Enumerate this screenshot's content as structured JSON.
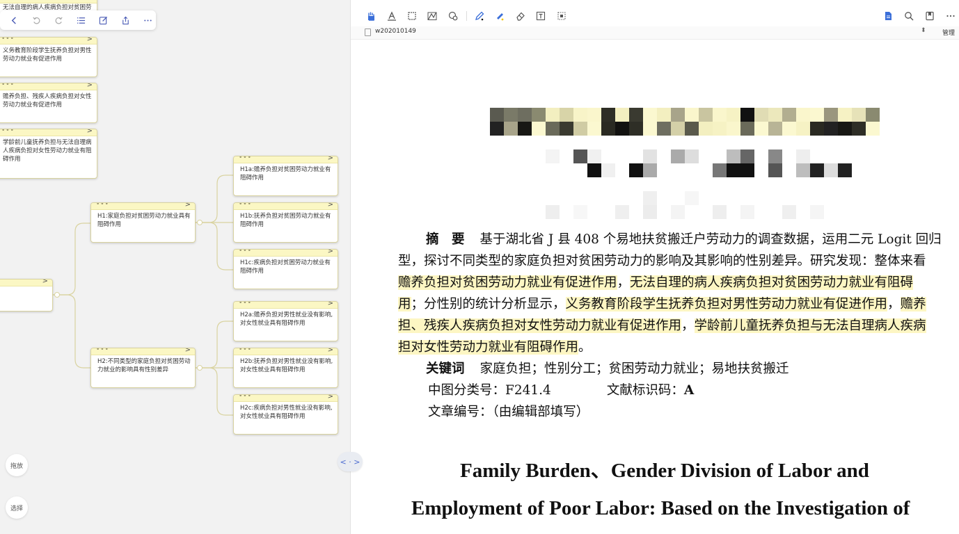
{
  "mindmap": {
    "toolbar": {
      "buttons": [
        "back-icon",
        "undo-icon",
        "redo-icon",
        "outline-icon",
        "edit-icon",
        "share-icon",
        "more-icon"
      ]
    },
    "nodes": {
      "n0": "无法自理的病人疾病负担对贫困劳动力就业有阻碍作用",
      "n1": "义务教育阶段学生抚养负担对男性劳动力就业有促进作用",
      "n2": "赡养负担、残疾人疾病负担对女性劳动力就业有促进作用",
      "n3": "学龄前儿童抚养负担与无法自理病人疾病负担对女性劳动力就业有阻碍作用",
      "root": "",
      "h1": "H1:家庭负担对贫困劳动力就业具有阻碍作用",
      "h2": "H2:不同类型的家庭负担对贫困劳动力就业的影响具有性别差异",
      "h1a": "H1a:赡养负担对贫困劳动力就业有阻碍作用",
      "h1b": "H1b:抚养负担对贫困劳动力就业有阻碍作用",
      "h1c": "H1c:疾病负担对贫困劳动力就业有阻碍作用",
      "h2a": "H2a:赡养负担对男性就业没有影响,对女性就业具有阻碍作用",
      "h2b": "H2b:抚养负担对男性就业没有影响,对女性就业具有阻碍作用",
      "h2c": "H2c:疾病负担对男性就业没有影响,对女性就业具有阻碍作用"
    },
    "modes": {
      "drag": "拖放",
      "select": "选择"
    },
    "node_colors": {
      "header": "#fbf7c4",
      "border": "#d9d3a0"
    }
  },
  "viewer": {
    "toolbar_left": [
      "hand-icon",
      "text-highlight-icon",
      "area-select-icon",
      "shape-icon",
      "stamp-icon",
      "pen-icon",
      "highlighter-icon",
      "eraser-icon",
      "textbox-icon",
      "crop-icon"
    ],
    "toolbar_right": [
      "document-icon",
      "search-icon",
      "bookmark-icon",
      "more-icon"
    ],
    "tab": {
      "name": "w202010149",
      "sort": "⬍",
      "manage": "管理"
    },
    "abstract": {
      "label": "摘　要",
      "l1": "基于湖北省 J 县 408 个易地扶贫搬迁户劳动力的调查数据，运用二元 Logit 回归",
      "l2": "型，探讨不同类型的家庭负担对贫困劳动力的影响及其影响的性别差异。研究发现：整体来看",
      "l3a": "赡养负担对贫困劳动力就业有促进作用",
      "l3b": "，",
      "l3c": "无法自理的病人疾病负担对贫困劳动力就业有阻碍",
      "l4a": "用",
      "l4b": "；分性别的统计分析显示，",
      "l4c": "义务教育阶段学生抚养负担对男性劳动力就业有促进作用",
      "l4d": "，",
      "l4e": "赡养",
      "l5a": "担、残疾人疾病负担对女性劳动力就业有促进作用",
      "l5b": "，",
      "l5c": "学龄前儿童抚养负担与无法自理病人疾病",
      "l6a": "担对女性劳动力就业有阻碍作用",
      "l6b": "。"
    },
    "keywords": {
      "label": "关键词",
      "text": "家庭负担；性别分工；贫困劳动力就业；易地扶贫搬迁"
    },
    "clc": {
      "label": "中图分类号：",
      "value": "F241.4",
      "doc_label": "文献标识码：",
      "doc_value": "A"
    },
    "article_no": "文章编号：（由编辑部填写）",
    "en_title_1": "Family Burden、Gender Division of Labor and",
    "en_title_2": "Employment of Poor Labor: Based on the Investigation of",
    "highlight_color": "#fdf6c3",
    "accent": "#3b6fd9"
  }
}
